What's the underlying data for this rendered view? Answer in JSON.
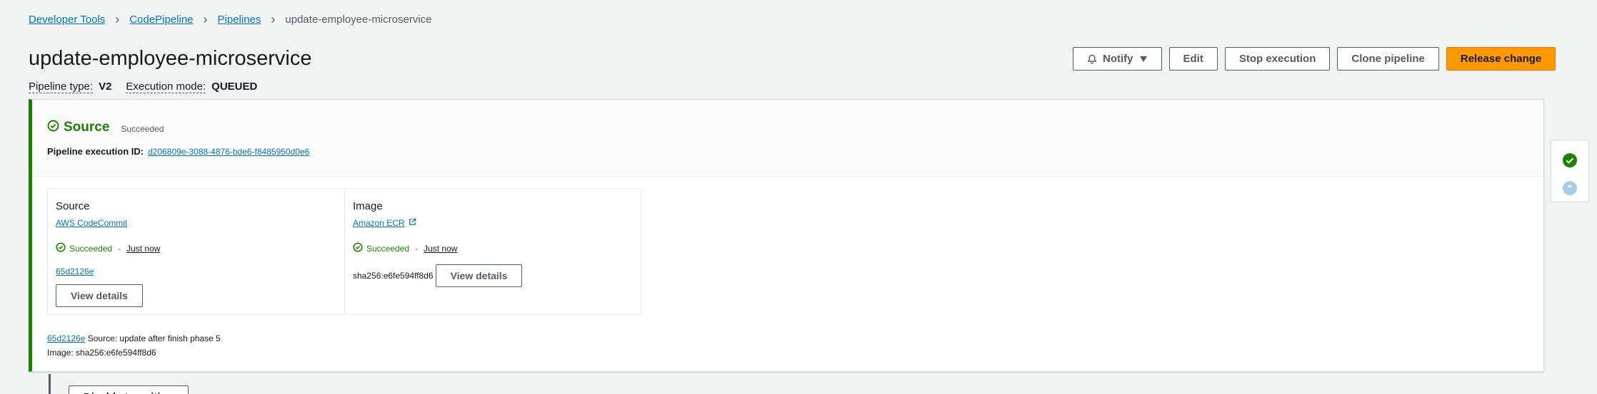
{
  "breadcrumb": [
    "Developer Tools",
    "CodePipeline",
    "Pipelines"
  ],
  "breadcrumb_current": "update-employee-microservice",
  "pipeline": {
    "name": "update-employee-microservice",
    "type_label": "Pipeline type:",
    "type_value": "V2",
    "mode_label": "Execution mode:",
    "mode_value": "QUEUED"
  },
  "toolbar": {
    "notify": "Notify",
    "edit": "Edit",
    "stop": "Stop execution",
    "clone": "Clone pipeline",
    "release": "Release change"
  },
  "stage": {
    "name": "Source",
    "status": "Succeeded",
    "exec_label": "Pipeline execution ID:",
    "exec_id": "d206809e-3088-4876-bde6-f8485950d0e6",
    "accent_color": "#1d8102"
  },
  "actions": [
    {
      "title": "Source",
      "provider": "AWS CodeCommit",
      "status": "Succeeded",
      "time": "Just now",
      "commit": "65d2126e",
      "button": "View details"
    },
    {
      "title": "Image",
      "provider": "Amazon ECR",
      "status": "Succeeded",
      "time": "Just now",
      "digest": "sha256:e6fe594ff8d6",
      "button": "View details"
    }
  ],
  "summary": {
    "commit": "65d2126e",
    "commit_message": "Source: update after finish phase 5",
    "image_line": "Image: sha256:e6fe594ff8d6"
  },
  "transition_button": "Disable transition",
  "colors": {
    "primary": "#ff9900",
    "success": "#1d8102",
    "link": "#0073bb",
    "pending": "#a6cde8"
  }
}
